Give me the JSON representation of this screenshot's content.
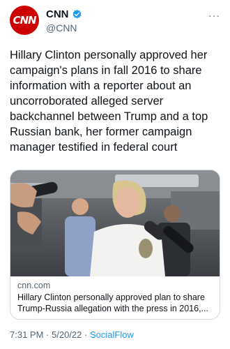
{
  "account": {
    "avatar_text": "CNN",
    "name": "CNN",
    "handle": "@CNN",
    "verified_color": "#1d9bf0",
    "more_icon": "more-dots"
  },
  "tweet": {
    "text": "Hillary Clinton personally approved her campaign's plans in fall 2016 to share information with a reporter about an uncorroborated alleged server backchannel between Trump and a top Russian bank, her former campaign manager testified in federal court"
  },
  "card": {
    "domain": "cnn.com",
    "title": "Hillary Clinton personally approved plan to share Trump-Russia allegation with the press in 2016,..."
  },
  "footer": {
    "time": "7:31 PM",
    "date": "5/20/22",
    "separator": "·",
    "source": "SocialFlow"
  },
  "colors": {
    "brand": "#cc0000",
    "link": "#1d9bf0",
    "secondary_text": "#536471"
  }
}
